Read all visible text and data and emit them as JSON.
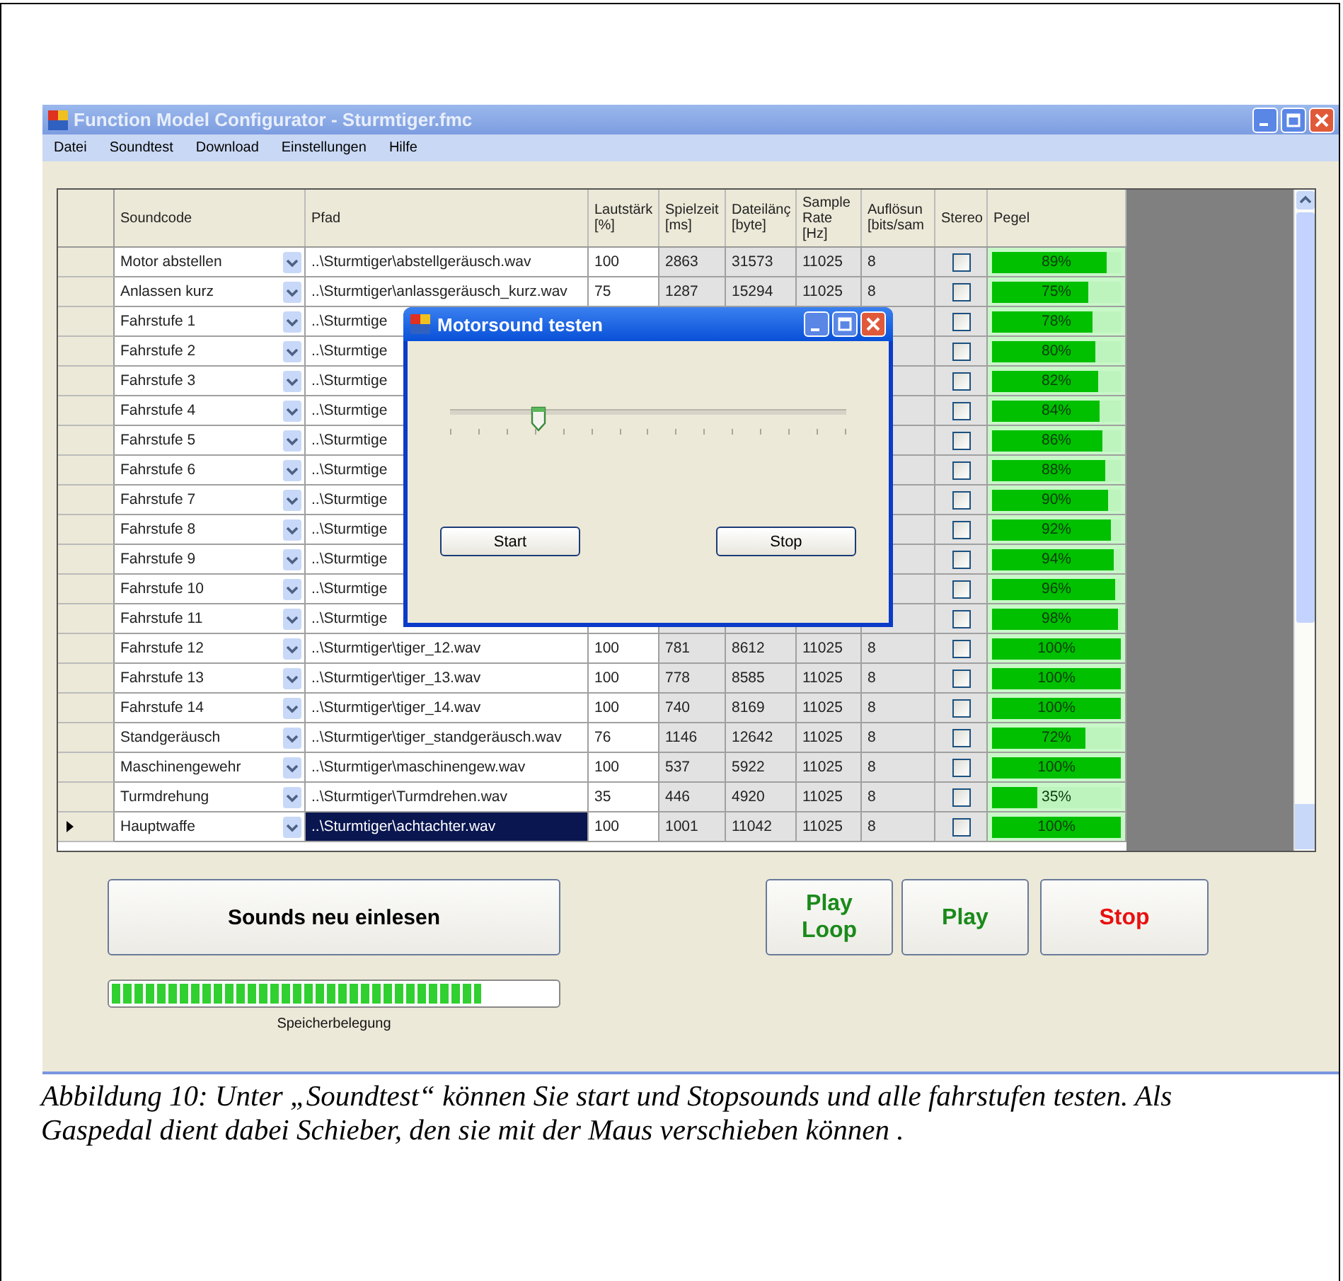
{
  "window": {
    "title": "Function Model Configurator - Sturmtiger.fmc"
  },
  "menu": [
    "Datei",
    "Soundtest",
    "Download",
    "Einstellungen",
    "Hilfe"
  ],
  "table": {
    "columns": [
      "Soundcode",
      "Pfad",
      "Lautstärk\n[%]",
      "Spielzeit\n[ms]",
      "Dateilänç\n[byte]",
      "Sample\nRate\n[Hz]",
      "Auflösun\n[bits/sam",
      "Stereo",
      "Pegel"
    ],
    "rows": [
      {
        "soundcode": "Motor abstellen",
        "path": "..\\Sturmtiger\\abstellgeräusch.wav",
        "volume": "100",
        "duration": "2863",
        "length": "31573",
        "rate": "11025",
        "bits": "8",
        "stereo": false,
        "pegel": "89%",
        "level": 0.89,
        "selected": false
      },
      {
        "soundcode": "Anlassen kurz",
        "path": "..\\Sturmtiger\\anlassgeräusch_kurz.wav",
        "volume": "75",
        "duration": "1287",
        "length": "15294",
        "rate": "11025",
        "bits": "8",
        "stereo": false,
        "pegel": "75%",
        "level": 0.75,
        "selected": false
      },
      {
        "soundcode": "Fahrstufe 1",
        "path": "..\\Sturmtige",
        "stereo": false,
        "pegel": "78%",
        "level": 0.78,
        "selected": false
      },
      {
        "soundcode": "Fahrstufe 2",
        "path": "..\\Sturmtige",
        "stereo": false,
        "pegel": "80%",
        "level": 0.8,
        "selected": false
      },
      {
        "soundcode": "Fahrstufe 3",
        "path": "..\\Sturmtige",
        "stereo": false,
        "pegel": "82%",
        "level": 0.82,
        "selected": false
      },
      {
        "soundcode": "Fahrstufe 4",
        "path": "..\\Sturmtige",
        "stereo": false,
        "pegel": "84%",
        "level": 0.84,
        "selected": false
      },
      {
        "soundcode": "Fahrstufe 5",
        "path": "..\\Sturmtige",
        "stereo": false,
        "pegel": "86%",
        "level": 0.86,
        "selected": false
      },
      {
        "soundcode": "Fahrstufe 6",
        "path": "..\\Sturmtige",
        "stereo": false,
        "pegel": "88%",
        "level": 0.88,
        "selected": false
      },
      {
        "soundcode": "Fahrstufe 7",
        "path": "..\\Sturmtige",
        "stereo": false,
        "pegel": "90%",
        "level": 0.9,
        "selected": false
      },
      {
        "soundcode": "Fahrstufe 8",
        "path": "..\\Sturmtige",
        "stereo": false,
        "pegel": "92%",
        "level": 0.92,
        "selected": false
      },
      {
        "soundcode": "Fahrstufe 9",
        "path": "..\\Sturmtige",
        "stereo": false,
        "pegel": "94%",
        "level": 0.94,
        "selected": false
      },
      {
        "soundcode": "Fahrstufe 10",
        "path": "..\\Sturmtige",
        "stereo": false,
        "pegel": "96%",
        "level": 0.96,
        "selected": false
      },
      {
        "soundcode": "Fahrstufe 11",
        "path": "..\\Sturmtige",
        "stereo": false,
        "pegel": "98%",
        "level": 0.98,
        "selected": false
      },
      {
        "soundcode": "Fahrstufe 12",
        "path": "..\\Sturmtiger\\tiger_12.wav",
        "volume": "100",
        "duration": "781",
        "length": "8612",
        "rate": "11025",
        "bits": "8",
        "stereo": false,
        "pegel": "100%",
        "level": 1,
        "selected": false
      },
      {
        "soundcode": "Fahrstufe 13",
        "path": "..\\Sturmtiger\\tiger_13.wav",
        "volume": "100",
        "duration": "778",
        "length": "8585",
        "rate": "11025",
        "bits": "8",
        "stereo": false,
        "pegel": "100%",
        "level": 1,
        "selected": false
      },
      {
        "soundcode": "Fahrstufe 14",
        "path": "..\\Sturmtiger\\tiger_14.wav",
        "volume": "100",
        "duration": "740",
        "length": "8169",
        "rate": "11025",
        "bits": "8",
        "stereo": false,
        "pegel": "100%",
        "level": 1,
        "selected": false
      },
      {
        "soundcode": "Standgeräusch",
        "path": "..\\Sturmtiger\\tiger_standgeräusch.wav",
        "volume": "76",
        "duration": "1146",
        "length": "12642",
        "rate": "11025",
        "bits": "8",
        "stereo": false,
        "pegel": "72%",
        "level": 0.72,
        "selected": false
      },
      {
        "soundcode": "Maschinengewehr",
        "path": "..\\Sturmtiger\\maschinengew.wav",
        "volume": "100",
        "duration": "537",
        "length": "5922",
        "rate": "11025",
        "bits": "8",
        "stereo": false,
        "pegel": "100%",
        "level": 1,
        "selected": false
      },
      {
        "soundcode": "Turmdrehung",
        "path": "..\\Sturmtiger\\Turmdrehen.wav",
        "volume": "35",
        "duration": "446",
        "length": "4920",
        "rate": "11025",
        "bits": "8",
        "stereo": false,
        "pegel": "35%",
        "level": 0.35,
        "selected": false
      },
      {
        "soundcode": "Hauptwaffe",
        "path": "..\\Sturmtiger\\achtachter.wav",
        "volume": "100",
        "duration": "1001",
        "length": "11042",
        "rate": "11025",
        "bits": "8",
        "stereo": false,
        "pegel": "100%",
        "level": 1,
        "selected": true
      }
    ]
  },
  "dialog": {
    "title": "Motorsound testen",
    "slider": {
      "level": 0.22
    },
    "buttons": [
      "Start",
      "Stop"
    ]
  },
  "reload_button": "Sounds neu einlesen",
  "memory": {
    "level": 0.83,
    "label": "Speicherbelegung"
  },
  "play_buttons": [
    {
      "label": "Play\nLoop",
      "color": "#1a8a1a"
    },
    {
      "label": "Play",
      "color": "#1a8a1a"
    },
    {
      "label": "Stop",
      "color": "#e81010"
    }
  ],
  "caption": "Abbildung 10: Unter „Soundtest“ können Sie start und Stopsounds und alle fahrstufen testen. Als Gaspedal dient dabei Schieber, den sie mit der Maus verschieben können ."
}
